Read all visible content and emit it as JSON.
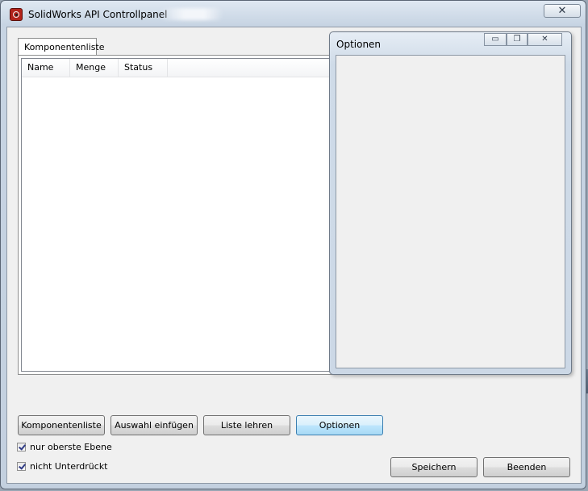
{
  "window": {
    "title": "SolidWorks API Controllpanel",
    "close_symbol": "✕"
  },
  "tabs": [
    {
      "label": "Komponentenliste"
    }
  ],
  "list": {
    "columns": [
      "Name",
      "Menge",
      "Status"
    ]
  },
  "options_window": {
    "title": "Optionen",
    "minimize_symbol": "▭",
    "restore_symbol": "❐",
    "close_symbol": "✕"
  },
  "buttons": {
    "komponentenliste": "Komponentenliste",
    "auswahl_einfuegen": "Auswahl einfügen",
    "liste_lehren": "Liste lehren",
    "optionen": "Optionen",
    "speichern": "Speichern",
    "beenden": "Beenden"
  },
  "checkboxes": [
    {
      "label": "nur oberste Ebene",
      "checked": true
    },
    {
      "label": "nicht Unterdrückt",
      "checked": true
    }
  ]
}
